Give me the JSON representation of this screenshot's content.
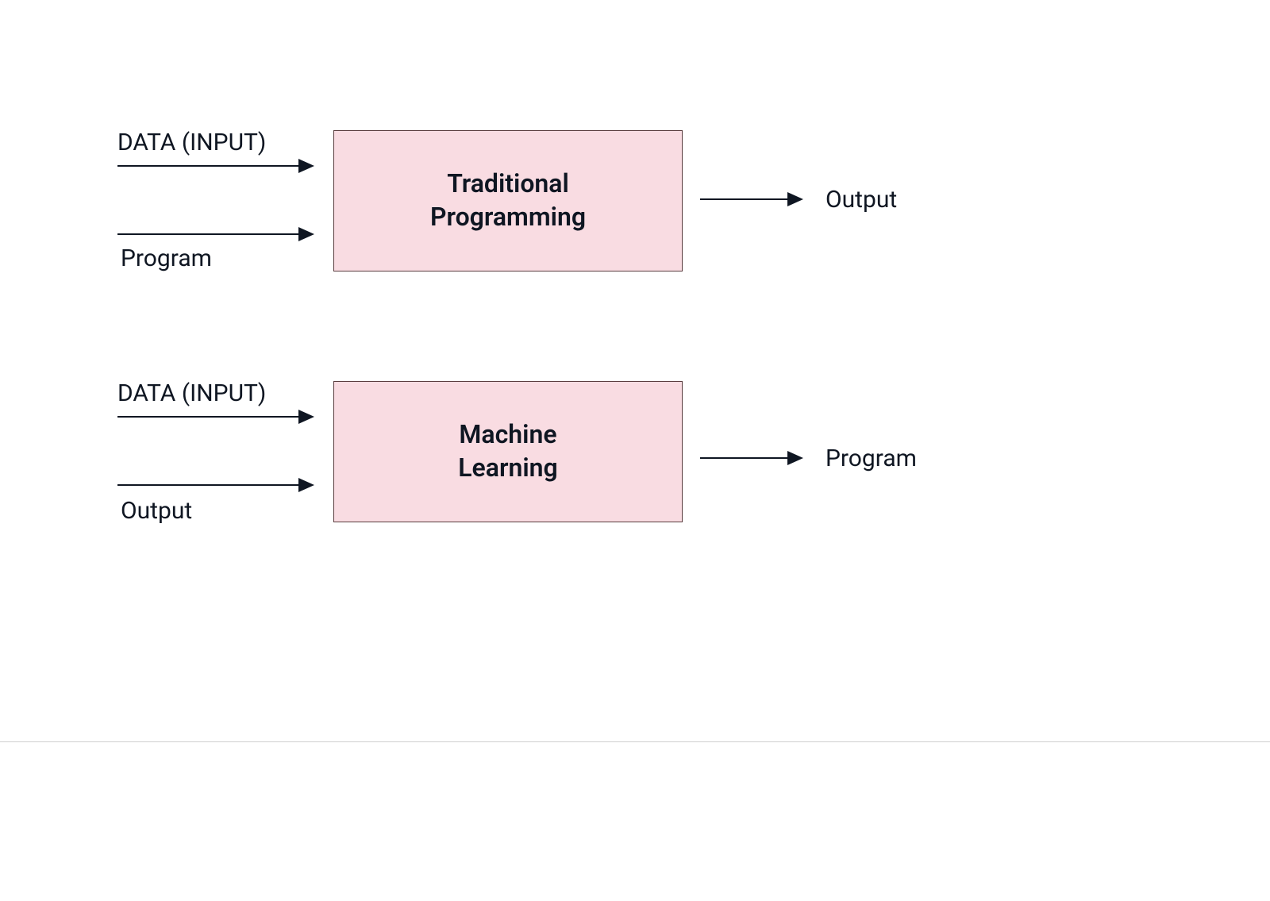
{
  "diagram": {
    "row1": {
      "input1": "DATA (INPUT)",
      "input2": "Program",
      "box": "Traditional\nProgramming",
      "output": "Output"
    },
    "row2": {
      "input1": "DATA (INPUT)",
      "input2": "Output",
      "box": "Machine\nLearning",
      "output": "Program"
    }
  },
  "colors": {
    "boxFill": "#f9dce2",
    "boxBorder": "#5a3d3f",
    "text": "#0f1622",
    "arrow": "#0f1622"
  }
}
